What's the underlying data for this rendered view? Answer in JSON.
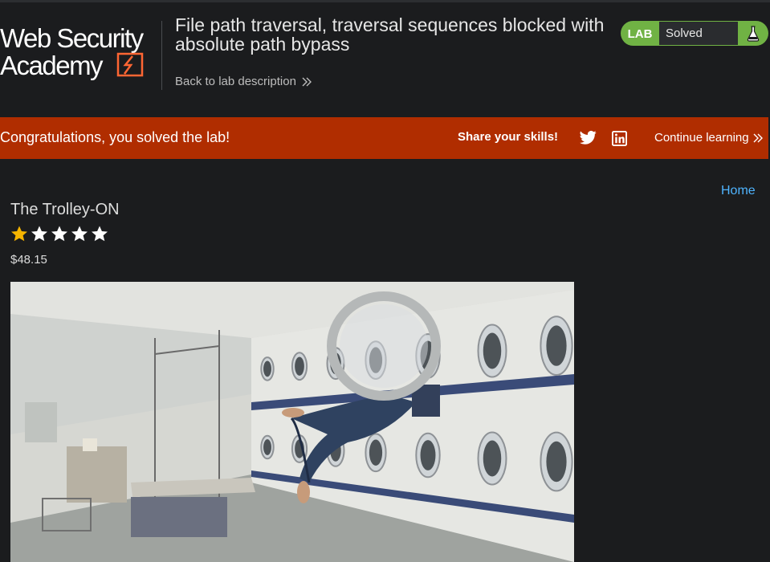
{
  "header": {
    "logo_lines": [
      "Web Security",
      "Academy"
    ],
    "lab_title": "File path traversal, traversal sequences blocked with absolute path bypass",
    "back_link": "Back to lab description",
    "status_badge": {
      "lab": "LAB",
      "status": "Solved"
    }
  },
  "banner": {
    "message": "Congratulations, you solved the lab!",
    "share_label": "Share your skills!",
    "continue_label": "Continue learning"
  },
  "nav": {
    "home": "Home"
  },
  "product": {
    "name": "The Trolley-ON",
    "rating": 1,
    "rating_max": 5,
    "price": "$48.15",
    "image_icon": "laundromat-photo"
  },
  "colors": {
    "accent_green": "#70b244",
    "banner_orange": "#b02d00",
    "link_blue": "#4fb4ff",
    "logo_orange": "#ff6633",
    "star_gold": "#f5b400"
  }
}
